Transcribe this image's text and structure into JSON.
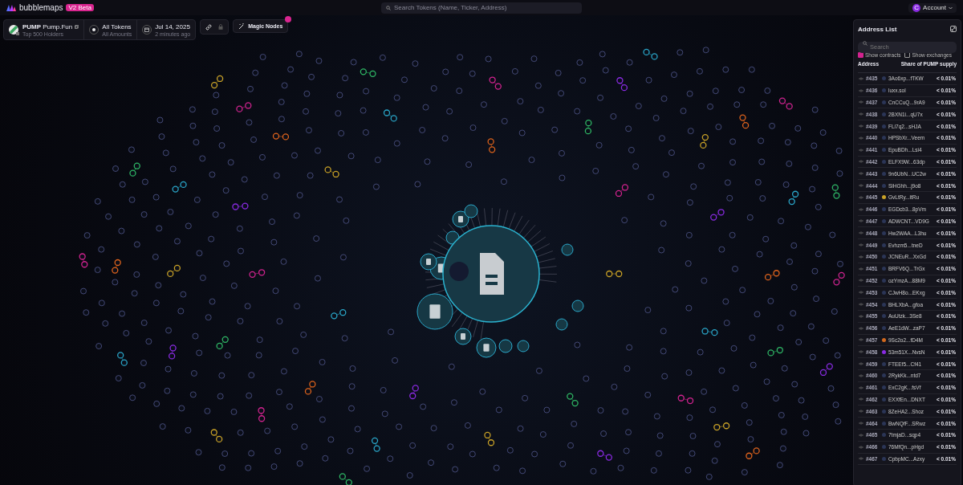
{
  "brand": {
    "name": "bubblemaps",
    "badge": "V2 Beta"
  },
  "search": {
    "placeholder": "Search Tokens (Name, Ticker, Address)"
  },
  "account": {
    "initial": "C",
    "label": "Account"
  },
  "token": {
    "ticker": "PUMP",
    "name": "Pump.Fun",
    "subtitle": "Top 500 Holders"
  },
  "filter": {
    "title": "All Tokens",
    "subtitle": "All Amounts"
  },
  "date": {
    "title": "Jul 14, 2025",
    "subtitle": "2 minutes ago"
  },
  "magic_nodes": {
    "label": "Magic Nodes"
  },
  "address_list": {
    "title": "Address List",
    "search_placeholder": "Search",
    "options": [
      {
        "label": "Show contracts",
        "checked": true
      },
      {
        "label": "Show exchanges",
        "checked": false
      }
    ],
    "columns": [
      "Address",
      "Share of PUMP supply"
    ],
    "rows": [
      {
        "rank": "#435",
        "address": "3Ao6xp...fTKW",
        "share": "< 0.01%",
        "color": "#2b3556"
      },
      {
        "rank": "#436",
        "address": "luxx.sol",
        "share": "< 0.01%",
        "color": "#2b3556"
      },
      {
        "rank": "#437",
        "address": "CnCCuQ...9rA9",
        "share": "< 0.01%",
        "color": "#2b3556"
      },
      {
        "rank": "#438",
        "address": "2BXN1i...qU7x",
        "share": "< 0.01%",
        "color": "#2b3556"
      },
      {
        "rank": "#439",
        "address": "FLi7q2...sHJA",
        "share": "< 0.01%",
        "color": "#2b3556"
      },
      {
        "rank": "#440",
        "address": "HPSbXr...Veem",
        "share": "< 0.01%",
        "color": "#2b3556"
      },
      {
        "rank": "#441",
        "address": "EpuBDh...Lsi4",
        "share": "< 0.01%",
        "color": "#2b3556"
      },
      {
        "rank": "#442",
        "address": "ELFX9W...63dp",
        "share": "< 0.01%",
        "color": "#2b3556"
      },
      {
        "rank": "#443",
        "address": "9n6UbN...UC2w",
        "share": "< 0.01%",
        "color": "#2b3556"
      },
      {
        "rank": "#444",
        "address": "SiHGhh...j9o8",
        "share": "< 0.01%",
        "color": "#2b3556"
      },
      {
        "rank": "#445",
        "address": "GvLtRy...itRu",
        "share": "< 0.01%",
        "color": "#c9a227"
      },
      {
        "rank": "#446",
        "address": "EGDcb3...8pVm",
        "share": "< 0.01%",
        "color": "#2b3556"
      },
      {
        "rank": "#447",
        "address": "ADWCNT...VD9G",
        "share": "< 0.01%",
        "color": "#2b3556"
      },
      {
        "rank": "#448",
        "address": "Hw2WAA...L3hu",
        "share": "< 0.01%",
        "color": "#2b3556"
      },
      {
        "rank": "#449",
        "address": "Evhzm5...tneD",
        "share": "< 0.01%",
        "color": "#2b3556"
      },
      {
        "rank": "#450",
        "address": "JCNEuR...XxGd",
        "share": "< 0.01%",
        "color": "#2b3556"
      },
      {
        "rank": "#451",
        "address": "BRFV6Q...TrGx",
        "share": "< 0.01%",
        "color": "#2b3556"
      },
      {
        "rank": "#452",
        "address": "ozYmzA...88M9",
        "share": "< 0.01%",
        "color": "#2b3556"
      },
      {
        "rank": "#453",
        "address": "CJwH8o...EKxg",
        "share": "< 0.01%",
        "color": "#2b3556"
      },
      {
        "rank": "#454",
        "address": "BHLXbA...gfoa",
        "share": "< 0.01%",
        "color": "#2b3556"
      },
      {
        "rank": "#455",
        "address": "AuUtzk...3Se8",
        "share": "< 0.01%",
        "color": "#2b3556"
      },
      {
        "rank": "#456",
        "address": "AeE1dW...zaP7",
        "share": "< 0.01%",
        "color": "#2b3556"
      },
      {
        "rank": "#457",
        "address": "9Sc2o2...fD4M",
        "share": "< 0.01%",
        "color": "#d2691e"
      },
      {
        "rank": "#458",
        "address": "53m51X...NvsN",
        "share": "< 0.01%",
        "color": "#8a2be2"
      },
      {
        "rank": "#459",
        "address": "FTEEf5...Cf41",
        "share": "< 0.01%",
        "color": "#2b3556"
      },
      {
        "rank": "#460",
        "address": "2RykKk...ntd7",
        "share": "< 0.01%",
        "color": "#2b3556"
      },
      {
        "rank": "#461",
        "address": "ExC2gK...fsVf",
        "share": "< 0.01%",
        "color": "#2b3556"
      },
      {
        "rank": "#462",
        "address": "EXXfEn...DNXT",
        "share": "< 0.01%",
        "color": "#2b3556"
      },
      {
        "rank": "#463",
        "address": "8ZeHA2...Shoz",
        "share": "< 0.01%",
        "color": "#2b3556"
      },
      {
        "rank": "#464",
        "address": "BwNQfF...SRwz",
        "share": "< 0.01%",
        "color": "#2b3556"
      },
      {
        "rank": "#465",
        "address": "7tmjaD...sqp4",
        "share": "< 0.01%",
        "color": "#2b3556"
      },
      {
        "rank": "#466",
        "address": "76MfQn...pHgd",
        "share": "< 0.01%",
        "color": "#2b3556"
      },
      {
        "rank": "#467",
        "address": "CpbpMC...Azxy",
        "share": "< 0.01%",
        "color": "#2b3556"
      }
    ]
  }
}
